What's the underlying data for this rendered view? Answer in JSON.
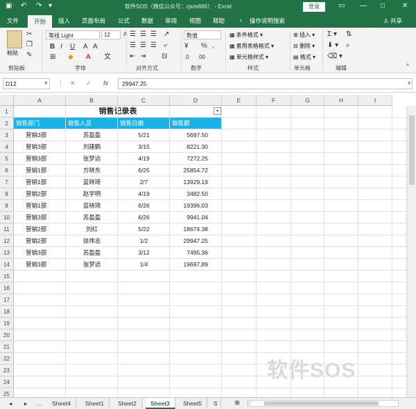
{
  "window": {
    "title": "软件SOS（微信公众号：rjsos666） - Excel",
    "login_button": "登录",
    "controls": [
      "—",
      "□",
      "✕"
    ]
  },
  "ribbon_tabs": [
    "文件",
    "开始",
    "插入",
    "页面布局",
    "公式",
    "数据",
    "审阅",
    "视图",
    "帮助"
  ],
  "active_tab": "开始",
  "tell_me": "操作说明搜索",
  "share": "共享",
  "ribbon": {
    "clipboard": {
      "label": "剪贴板",
      "paste": "粘贴"
    },
    "font": {
      "label": "字体",
      "name": "等线 Light",
      "size": "12"
    },
    "alignment": {
      "label": "对齐方式"
    },
    "number": {
      "label": "数字",
      "format": "数值"
    },
    "styles": {
      "label": "样式",
      "items": [
        "条件格式",
        "套用表格格式",
        "单元格样式"
      ]
    },
    "cells": {
      "label": "单元格",
      "items": [
        "插入",
        "删除",
        "格式"
      ]
    },
    "editing": {
      "label": "编辑"
    }
  },
  "formula_bar": {
    "name_box": "D12",
    "formula": "29947.25"
  },
  "columns": [
    "A",
    "B",
    "C",
    "D",
    "E",
    "F",
    "G",
    "H",
    "I"
  ],
  "rows": [
    "1",
    "2",
    "3",
    "4",
    "5",
    "6",
    "7",
    "8",
    "9",
    "10",
    "11",
    "12",
    "13",
    "14",
    "15",
    "16",
    "17",
    "18",
    "19",
    "20",
    "21",
    "22",
    "23",
    "24",
    "25"
  ],
  "table": {
    "title": "销售记录表",
    "headers": [
      "销售部门",
      "销售人员",
      "销售日期",
      "销售额"
    ],
    "rows": [
      [
        "营销3部",
        "苏盈盈",
        "5/21",
        "5697.50"
      ],
      [
        "营销3部",
        "刘建鹏",
        "3/15",
        "8221.30"
      ],
      [
        "营销3部",
        "张梦远",
        "4/19",
        "7272.25"
      ],
      [
        "营销1部",
        "方晓东",
        "6/25",
        "25854.72"
      ],
      [
        "营销1部",
        "蓝晓琦",
        "2/7",
        "13929.19"
      ],
      [
        "营销2部",
        "赵宇明",
        "4/19",
        "3482.50"
      ],
      [
        "营销1部",
        "蓝晓琦",
        "6/26",
        "19396.03"
      ],
      [
        "营销3部",
        "苏盈盈",
        "6/26",
        "9941.04"
      ],
      [
        "营销2部",
        "刘红",
        "5/22",
        "18674.38"
      ],
      [
        "营销2部",
        "徐伟志",
        "1/2",
        "29947.25"
      ],
      [
        "营销3部",
        "苏盈盈",
        "3/12",
        "7495.36"
      ],
      [
        "营销3部",
        "张梦远",
        "1/4",
        "19697.89"
      ]
    ]
  },
  "sheets": [
    "Sheet4",
    "Sheet1",
    "Sheet2",
    "Sheet3",
    "Sheet5",
    "S"
  ],
  "active_sheet": "Sheet3",
  "watermark": "软件SOS",
  "colors": {
    "excel_green": "#217346",
    "header_fill": "#1ab1e6"
  }
}
